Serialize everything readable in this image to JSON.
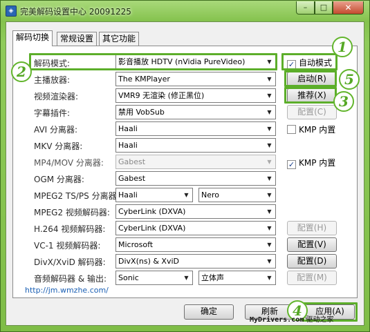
{
  "window": {
    "title": "完美解码设置中心 20091225",
    "min_glyph": "–",
    "max_glyph": "□",
    "close_glyph": "✕"
  },
  "tabs": [
    "解码切换",
    "常规设置",
    "其它功能"
  ],
  "rows": [
    {
      "label": "解码模式:",
      "value": "影音播放 HDTV (nVidia PureVideo)"
    },
    {
      "label": "主播放器:",
      "value": "The KMPlayer"
    },
    {
      "label": "视频渲染器:",
      "value": "VMR9 无渲染 (修正黑位)"
    },
    {
      "label": "字幕插件:",
      "value": "禁用 VobSub"
    },
    {
      "label": "AVI 分离器:",
      "value": "Haali"
    },
    {
      "label": "MKV 分离器:",
      "value": "Haali"
    },
    {
      "label": "MP4/MOV 分离器:",
      "value": "Gabest",
      "disabled": true
    },
    {
      "label": "OGM 分离器:",
      "value": "Gabest"
    },
    {
      "label": "MPEG2 TS/PS 分离器:",
      "value": "Haali",
      "value2": "Nero"
    },
    {
      "label": "MPEG2 视频解码器:",
      "value": "CyberLink (DXVA)"
    },
    {
      "label": "H.264 视频解码器:",
      "value": "CyberLink (DXVA)"
    },
    {
      "label": "VC-1 视频解码器:",
      "value": "Microsoft"
    },
    {
      "label": "DivX/XviD 解码器:",
      "value": "DivX(ns) & XviD"
    },
    {
      "label": "音频解码器 & 输出:",
      "value": "Sonic",
      "value2": "立体声"
    }
  ],
  "checks": {
    "auto_mode": {
      "label": "自动模式",
      "checked": true
    },
    "avi_kmp": {
      "label": "KMP 内置",
      "checked": false
    },
    "mp4_kmp": {
      "label": "KMP 内置",
      "checked": true
    }
  },
  "side_buttons": {
    "start": "启动(R)",
    "recommend": "推荐(X)",
    "subtitle_config": "配置(C)",
    "h264_config": "配置(H)",
    "vc1_config": "配置(V)",
    "divx_config": "配置(D)",
    "audio_config": "配置(M)"
  },
  "footer": {
    "link": "http://jm.wmzhe.com/",
    "ok": "确定",
    "refresh": "刷新",
    "apply": "应用(A)"
  },
  "badges": [
    "1",
    "2",
    "3",
    "4",
    "5"
  ],
  "watermark": {
    "part1": "MyDrivers.com",
    "part2": "驱动之家"
  },
  "colors": {
    "window_green": "#84c24d",
    "highlight_green": "#5cae2a",
    "link_blue": "#1a5fb4"
  }
}
